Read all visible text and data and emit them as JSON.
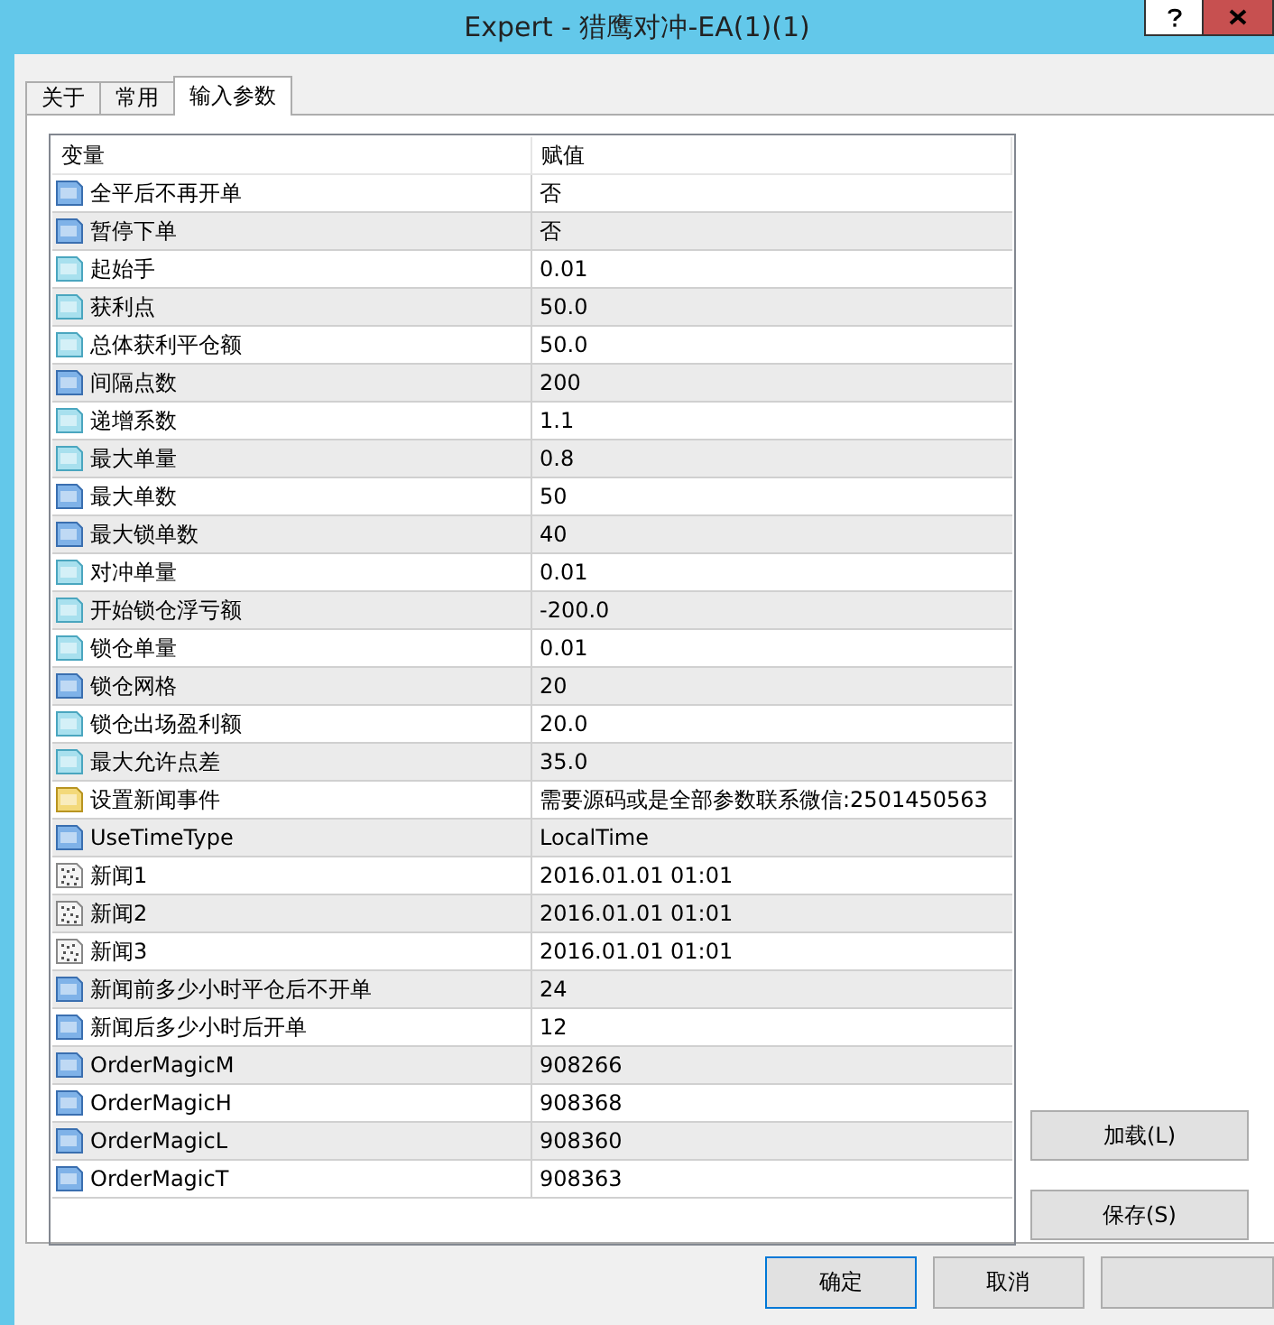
{
  "window": {
    "title": "Expert - 猎鹰对冲-EA(1)(1)"
  },
  "tabs": [
    {
      "label": "关于",
      "selected": false
    },
    {
      "label": "常用",
      "selected": false
    },
    {
      "label": "输入参数",
      "selected": true
    }
  ],
  "table": {
    "columns": [
      "变量",
      "赋值"
    ],
    "rows": [
      {
        "kind": "int",
        "name": "全平后不再开单",
        "value": "否"
      },
      {
        "kind": "int",
        "name": "暂停下单",
        "value": "否"
      },
      {
        "kind": "double",
        "name": "起始手",
        "value": "0.01"
      },
      {
        "kind": "double",
        "name": "获利点",
        "value": "50.0"
      },
      {
        "kind": "double",
        "name": "总体获利平仓额",
        "value": "50.0"
      },
      {
        "kind": "int",
        "name": "间隔点数",
        "value": "200"
      },
      {
        "kind": "double",
        "name": "递增系数",
        "value": "1.1"
      },
      {
        "kind": "double",
        "name": "最大单量",
        "value": "0.8"
      },
      {
        "kind": "int",
        "name": "最大单数",
        "value": "50"
      },
      {
        "kind": "int",
        "name": "最大锁单数",
        "value": "40"
      },
      {
        "kind": "double",
        "name": "对冲单量",
        "value": "0.01"
      },
      {
        "kind": "double",
        "name": "开始锁仓浮亏额",
        "value": "-200.0"
      },
      {
        "kind": "double",
        "name": "锁仓单量",
        "value": "0.01"
      },
      {
        "kind": "int",
        "name": "锁仓网格",
        "value": "20"
      },
      {
        "kind": "double",
        "name": "锁仓出场盈利额",
        "value": "20.0"
      },
      {
        "kind": "double",
        "name": "最大允许点差",
        "value": "35.0"
      },
      {
        "kind": "string",
        "name": "设置新闻事件",
        "value": "需要源码或是全部参数联系微信:2501450563"
      },
      {
        "kind": "int",
        "name": "UseTimeType",
        "value": "LocalTime"
      },
      {
        "kind": "datetime",
        "name": "新闻1",
        "value": "2016.01.01 01:01"
      },
      {
        "kind": "datetime",
        "name": "新闻2",
        "value": "2016.01.01 01:01"
      },
      {
        "kind": "datetime",
        "name": "新闻3",
        "value": "2016.01.01 01:01"
      },
      {
        "kind": "int",
        "name": "新闻前多少小时平仓后不开单",
        "value": "24"
      },
      {
        "kind": "int",
        "name": "新闻后多少小时后开单",
        "value": "12"
      },
      {
        "kind": "int",
        "name": "OrderMagicM",
        "value": "908266"
      },
      {
        "kind": "int",
        "name": "OrderMagicH",
        "value": "908368"
      },
      {
        "kind": "int",
        "name": "OrderMagicL",
        "value": "908360"
      },
      {
        "kind": "int",
        "name": "OrderMagicT",
        "value": "908363"
      }
    ]
  },
  "side_buttons": [
    "加载(L)",
    "保存(S)"
  ],
  "dialog_buttons": [
    {
      "label": "确定",
      "default": true
    },
    {
      "label": "取消",
      "default": false
    },
    {
      "default": false
    }
  ]
}
